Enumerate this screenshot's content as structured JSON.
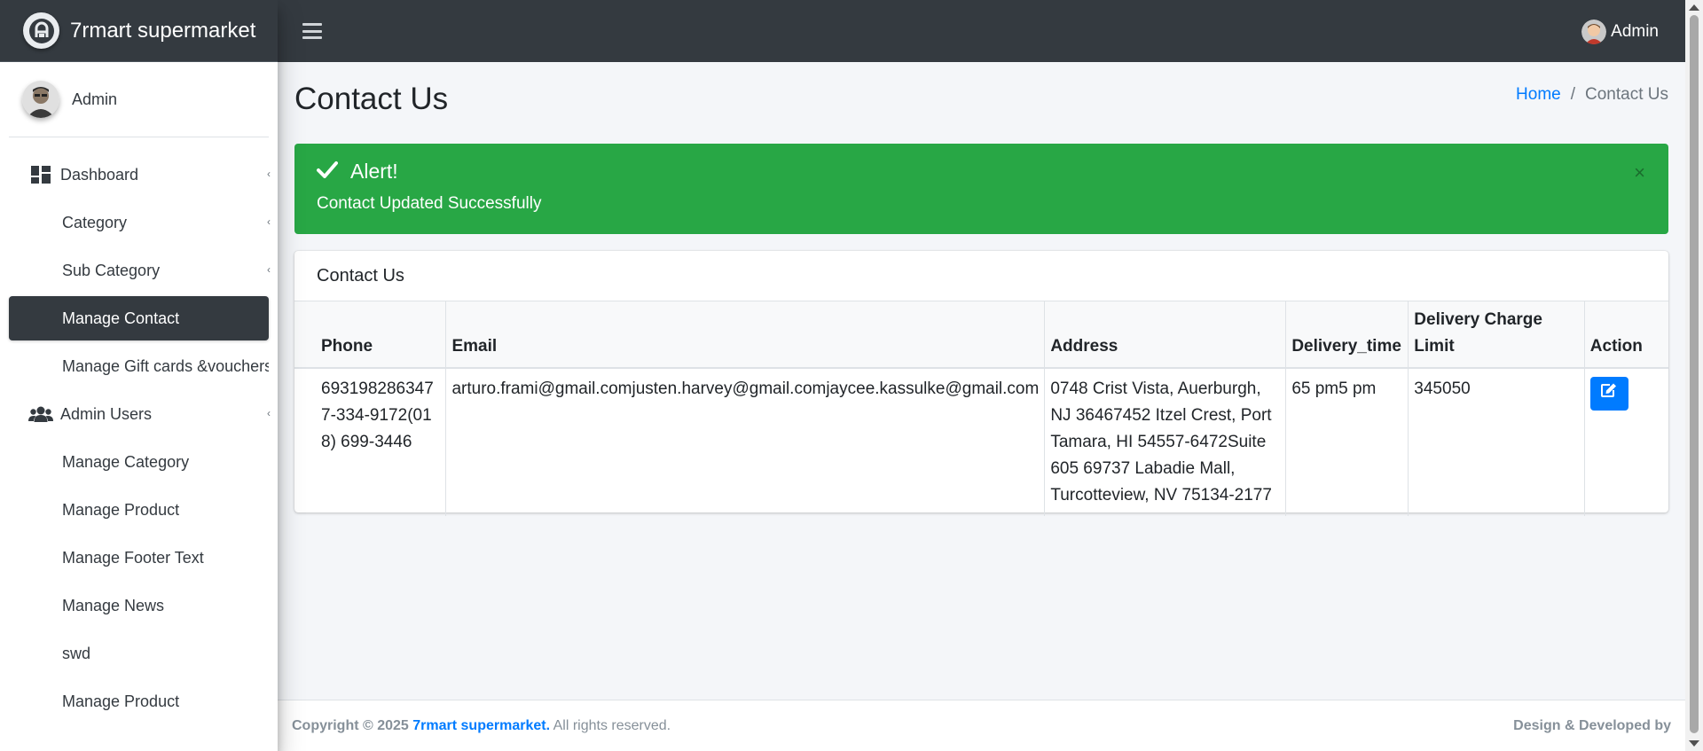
{
  "brand": {
    "name": "7rmart supermarket",
    "logo_icon": "brand-logo-icon"
  },
  "sidebar": {
    "user_name": "Admin",
    "items": [
      {
        "label": "Dashboard",
        "icon": "dashboard-icon",
        "has_chevron": true
      },
      {
        "label": "Category",
        "has_chevron": true
      },
      {
        "label": "Sub Category",
        "has_chevron": true
      },
      {
        "label": "Manage Contact",
        "active": true
      },
      {
        "label": "Manage Gift cards &vouchers"
      },
      {
        "label": "Admin Users",
        "icon": "users-icon",
        "has_chevron": true
      },
      {
        "label": "Manage Category"
      },
      {
        "label": "Manage Product"
      },
      {
        "label": "Manage Footer Text"
      },
      {
        "label": "Manage News"
      },
      {
        "label": "swd"
      },
      {
        "label": "Manage Product"
      }
    ]
  },
  "navbar": {
    "user_label": "Admin"
  },
  "page": {
    "title": "Contact Us",
    "breadcrumb": {
      "home": "Home",
      "separator": "/",
      "current": "Contact Us"
    }
  },
  "alert": {
    "title": "Alert!",
    "message": "Contact Updated Successfully",
    "close": "×",
    "color": "#28a745"
  },
  "card": {
    "title": "Contact Us",
    "table": {
      "headers": [
        "Phone",
        "Email",
        "Address",
        "Delivery_time",
        "Delivery Charge Limit",
        "Action"
      ],
      "rows": [
        {
          "phone": "6931982863477-334-9172(018) 699-3446",
          "email": "arturo.frami@gmail.comjusten.harvey@gmail.comjaycee.kassulke@gmail.com",
          "address": "0748 Crist Vista, Auerburgh, NJ 36467452 Itzel Crest, Port Tamara, HI 54557-6472Suite 605 69737 Labadie Mall, Turcotteview, NV 75134-2177",
          "delivery_time": "65 pm5 pm",
          "delivery_charge_limit": "345050",
          "action_icon": "edit-icon"
        }
      ]
    }
  },
  "footer": {
    "copyright": "Copyright © 2025",
    "brand_link": "7rmart supermarket.",
    "rights": "All rights reserved.",
    "credit": "Design & Developed by"
  },
  "colors": {
    "dark": "#343a40",
    "primary": "#007bff",
    "success": "#28a745",
    "background": "#f4f6f9"
  }
}
